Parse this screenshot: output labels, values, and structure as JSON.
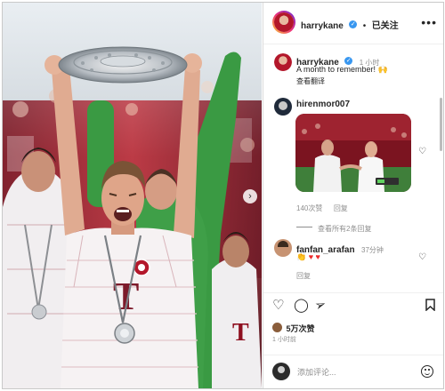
{
  "header": {
    "username": "harrykane",
    "separator": "•",
    "follow_label": "已关注",
    "more_label": "•••"
  },
  "caption": {
    "username": "harrykane",
    "time": "1 小时",
    "text": "A month to remember! 🙌",
    "translate_label": "查看翻译"
  },
  "comments": [
    {
      "username": "hirenmor007",
      "likes": "140次赞",
      "reply_label": "回复",
      "view_replies_label": "查看所有2条回复"
    },
    {
      "username": "fanfan_arafan",
      "time": "37分钟",
      "text": "👏 ♥ ♥",
      "reply_label": "回复"
    }
  ],
  "post": {
    "likes": "5万次赞",
    "time": "1 小时前"
  },
  "add_comment": {
    "placeholder": "添加评论..."
  },
  "colors": {
    "verified": "#3897f0",
    "jersey_red": "#b3172b",
    "goalkeeper_green": "#3a9a43",
    "comment_heart": "#ed2b2b"
  },
  "icons": [
    "verified-icon",
    "more-icon",
    "heart-icon",
    "comment-icon",
    "share-icon",
    "bookmark-icon",
    "emoji-icon",
    "chevron-right-icon"
  ]
}
